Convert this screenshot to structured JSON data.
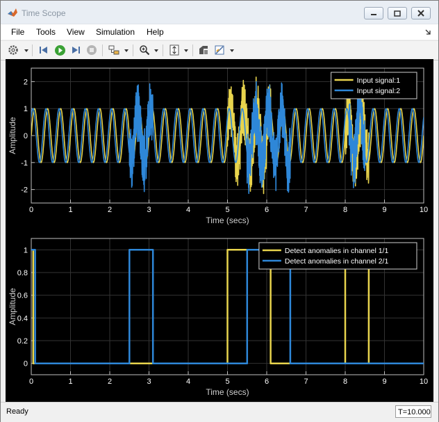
{
  "window": {
    "title": "Time Scope"
  },
  "menu": [
    "File",
    "Tools",
    "View",
    "Simulation",
    "Help"
  ],
  "toolbar": {
    "icons": [
      "settings-icon",
      "step-back-icon",
      "run-icon",
      "step-forward-icon",
      "stop-icon",
      "highlight-block-icon",
      "zoom-in-icon",
      "autoscale-icon",
      "simulink-icon",
      "measurements-icon"
    ]
  },
  "colors": {
    "series1": "#e8d44d",
    "series2": "#2e87d8",
    "axes_bg": "#000000",
    "grid": "#333333",
    "axis_text": "#ffffff"
  },
  "chart_data": [
    {
      "type": "line",
      "xlabel": "Time (secs)",
      "ylabel": "Amplitude",
      "xlim": [
        0,
        10
      ],
      "ylim": [
        -2.5,
        2.5
      ],
      "xticks": [
        0,
        1,
        2,
        3,
        4,
        5,
        6,
        7,
        8,
        9,
        10
      ],
      "yticks": [
        -2,
        -1,
        0,
        1,
        2
      ],
      "grid": true,
      "legend_position": "top-right",
      "series": [
        {
          "name": "Input signal:1",
          "color": "#e8d44d",
          "description": "sine wave amplitude 1, about 3 cycles per second",
          "amplitude": 1,
          "frequency_hz": 3.0,
          "anomaly_windows": [
            [
              5.0,
              6.1
            ],
            [
              8.0,
              8.6
            ]
          ]
        },
        {
          "name": "Input signal:2",
          "color": "#2e87d8",
          "description": "sine wave amplitude 1, about 3 cycles per second",
          "amplitude": 1,
          "frequency_hz": 3.0,
          "anomaly_windows": [
            [
              2.5,
              3.1
            ],
            [
              5.5,
              6.6
            ],
            [
              8.1,
              8.5
            ]
          ]
        }
      ]
    },
    {
      "type": "line",
      "xlabel": "Time (secs)",
      "ylabel": "Amplitude",
      "xlim": [
        0,
        10
      ],
      "ylim": [
        -0.1,
        1.1
      ],
      "xticks": [
        0,
        1,
        2,
        3,
        4,
        5,
        6,
        7,
        8,
        9,
        10
      ],
      "yticks": [
        0,
        0.2,
        0.4,
        0.6,
        0.8,
        1
      ],
      "grid": true,
      "legend_position": "top-right",
      "series": [
        {
          "name": "Detect anomalies in channel 1/1",
          "color": "#e8d44d",
          "x": [
            0,
            0.05,
            0.05,
            5.0,
            5.0,
            6.1,
            6.1,
            8.0,
            8.0,
            8.6,
            8.6,
            10
          ],
          "y": [
            1,
            1,
            0,
            0,
            1,
            1,
            0,
            0,
            1,
            1,
            0,
            0
          ]
        },
        {
          "name": "Detect anomalies in channel 2/1",
          "color": "#2e87d8",
          "x": [
            0,
            0.1,
            0.1,
            2.5,
            2.5,
            3.1,
            3.1,
            5.5,
            5.5,
            6.6,
            6.6,
            10
          ],
          "y": [
            1,
            1,
            0,
            0,
            1,
            1,
            0,
            0,
            1,
            1,
            0,
            0
          ]
        }
      ]
    }
  ],
  "status": {
    "text": "Ready",
    "time": "T=10.000"
  }
}
